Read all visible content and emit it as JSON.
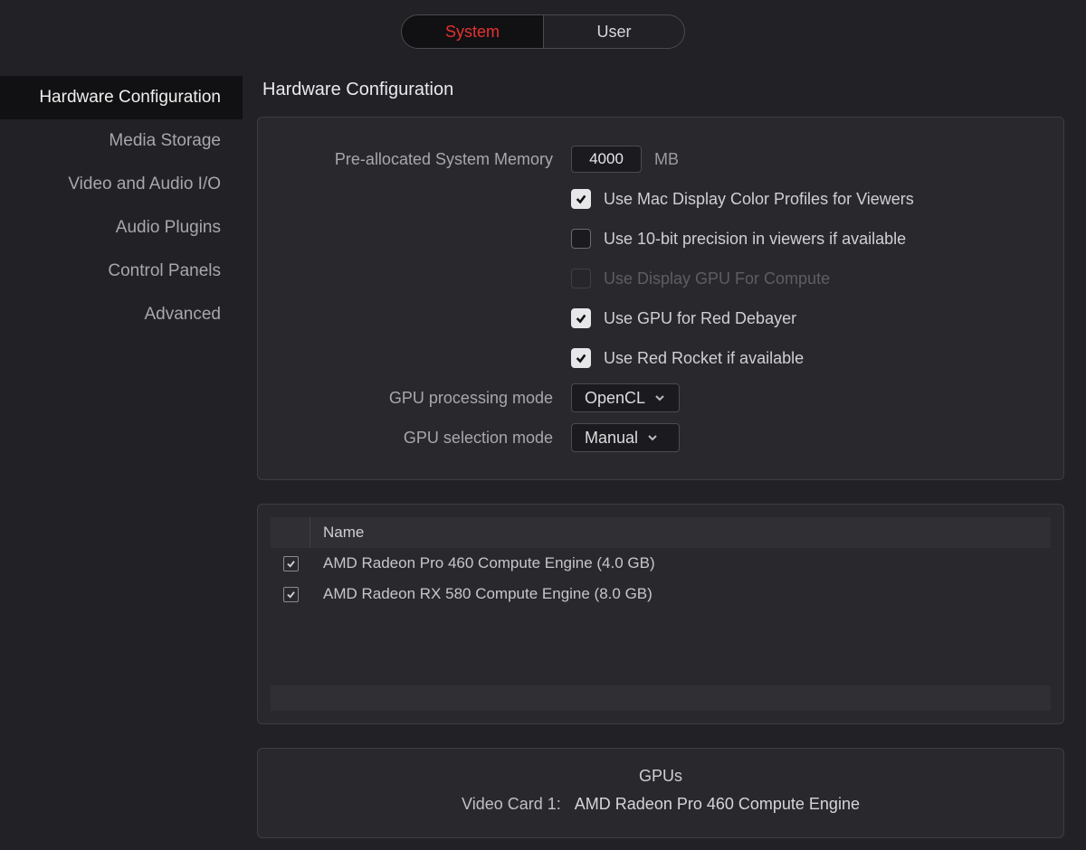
{
  "tabs": {
    "system": "System",
    "user": "User",
    "active": "system"
  },
  "sidebar": {
    "items": [
      "Hardware Configuration",
      "Media Storage",
      "Video and Audio I/O",
      "Audio Plugins",
      "Control Panels",
      "Advanced"
    ],
    "active_index": 0
  },
  "page_title": "Hardware Configuration",
  "form": {
    "mem_label": "Pre-allocated System Memory",
    "mem_value": "4000",
    "mem_unit": "MB",
    "checks": [
      {
        "label": "Use Mac Display Color Profiles for Viewers",
        "checked": true,
        "disabled": false
      },
      {
        "label": "Use 10-bit precision in viewers if available",
        "checked": false,
        "disabled": false
      },
      {
        "label": "Use Display GPU For Compute",
        "checked": false,
        "disabled": true
      },
      {
        "label": "Use GPU for Red Debayer",
        "checked": true,
        "disabled": false
      },
      {
        "label": "Use Red Rocket if available",
        "checked": true,
        "disabled": false
      }
    ],
    "gpu_proc_label": "GPU processing mode",
    "gpu_proc_value": "OpenCL",
    "gpu_sel_label": "GPU selection mode",
    "gpu_sel_value": "Manual"
  },
  "gpu_table": {
    "header_name": "Name",
    "rows": [
      {
        "name": "AMD Radeon Pro 460 Compute Engine (4.0 GB)",
        "checked": true
      },
      {
        "name": "AMD Radeon RX 580 Compute Engine (8.0 GB)",
        "checked": true
      }
    ]
  },
  "gpu_info": {
    "title": "GPUs",
    "card_label": "Video Card 1:",
    "card_value": "AMD Radeon Pro 460 Compute Engine"
  }
}
